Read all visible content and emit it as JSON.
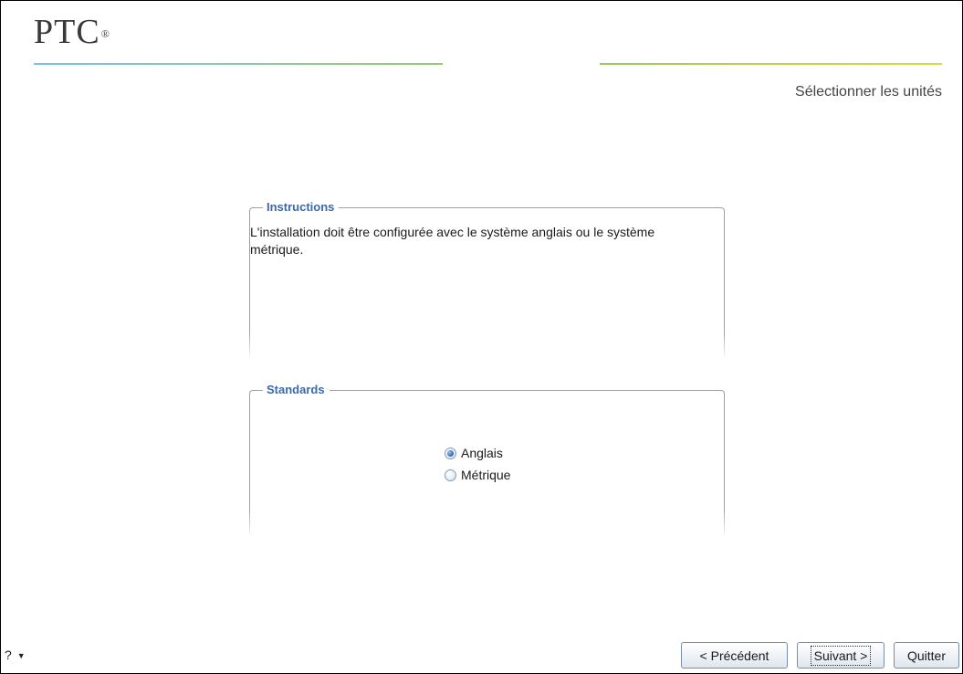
{
  "header": {
    "logo_text": "PTC",
    "logo_mark": "®",
    "step_title": "Sélectionner les unités",
    "rule_colors": [
      "#74c3e8",
      "#97cb6e",
      "#d8dc3c"
    ]
  },
  "instructions": {
    "legend": "Instructions",
    "text": "L'installation doit être configurée avec le système anglais ou le système métrique."
  },
  "standards": {
    "legend": "Standards",
    "options": [
      {
        "label": "Anglais",
        "selected": true
      },
      {
        "label": "Métrique",
        "selected": false
      }
    ]
  },
  "footer": {
    "help_label": "?",
    "help_icon": "caret-down-icon",
    "prev_label": "< Précédent",
    "next_label": "Suivant >",
    "quit_label": "Quitter"
  },
  "colors": {
    "legend": "#3c6aa8",
    "group_border": "#8ba5bd"
  }
}
